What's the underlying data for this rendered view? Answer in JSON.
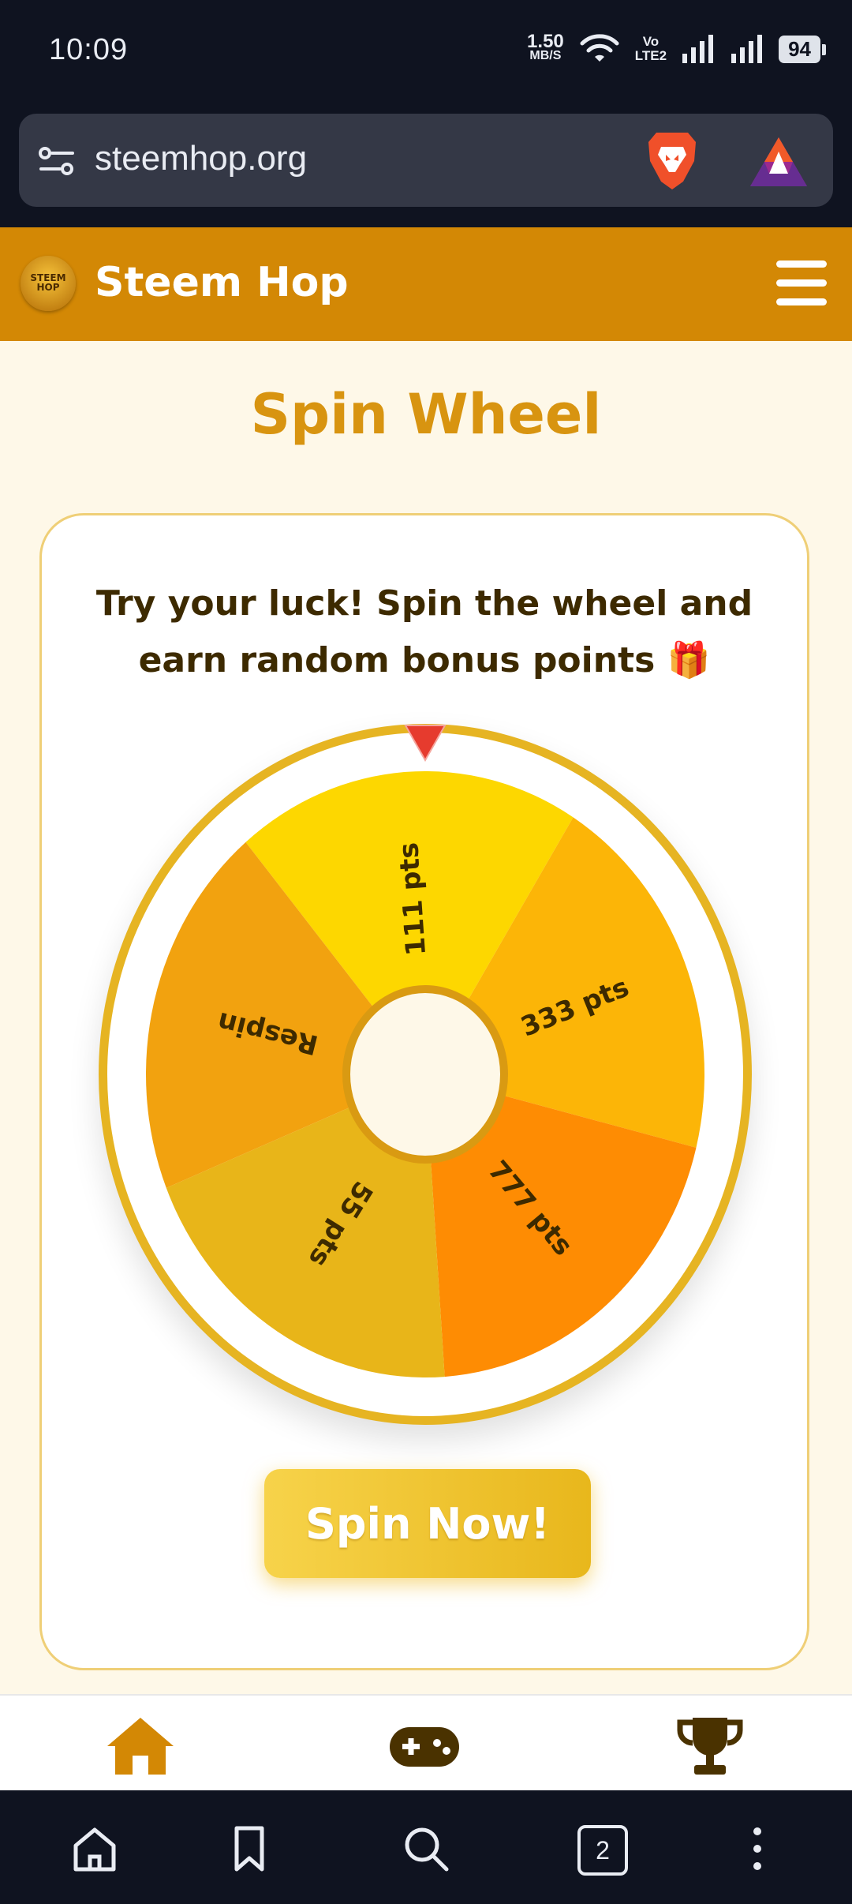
{
  "status_bar": {
    "time": "10:09",
    "net_speed_value": "1.50",
    "net_speed_unit": "MB/S",
    "volte_top": "Vo",
    "volte_bottom": "LTE2",
    "battery": "94"
  },
  "browser": {
    "url": "steemhop.org",
    "icons": [
      "site-settings-icon",
      "brave-lion-icon",
      "bat-rewards-icon"
    ]
  },
  "header": {
    "logo_text_top": "STEEM",
    "logo_text_bottom": "HOP",
    "brand": "Steem Hop",
    "menu_icon": "hamburger-menu-icon"
  },
  "main": {
    "title": "Spin Wheel",
    "intro_line1": "Try your luck! Spin the wheel and",
    "intro_line2": "earn random bonus points 🎁",
    "spin_button": "Spin Now!"
  },
  "wheel": {
    "segments": [
      {
        "label": "111 pts",
        "color": "#fdd700"
      },
      {
        "label": "333 pts",
        "color": "#fcb507"
      },
      {
        "label": "777 pts",
        "color": "#fe8c03"
      },
      {
        "label": "55 pts",
        "color": "#e8b519"
      },
      {
        "label": "Respin",
        "color": "#f2a20f"
      }
    ],
    "ring_color": "#e6b422",
    "pointer_color": "#e63b2e"
  },
  "app_nav": {
    "items": [
      "home-icon",
      "gamepad-icon",
      "trophy-icon"
    ],
    "active_color": "#d38805",
    "inactive_color": "#4a3200"
  },
  "browser_nav": {
    "tab_count": "2",
    "items": [
      "home-icon",
      "bookmark-icon",
      "search-icon",
      "tabs-icon",
      "more-menu-icon"
    ]
  },
  "colors": {
    "header_bg": "#d38805",
    "title": "#d89410",
    "page_bg": "#fef8e8"
  }
}
